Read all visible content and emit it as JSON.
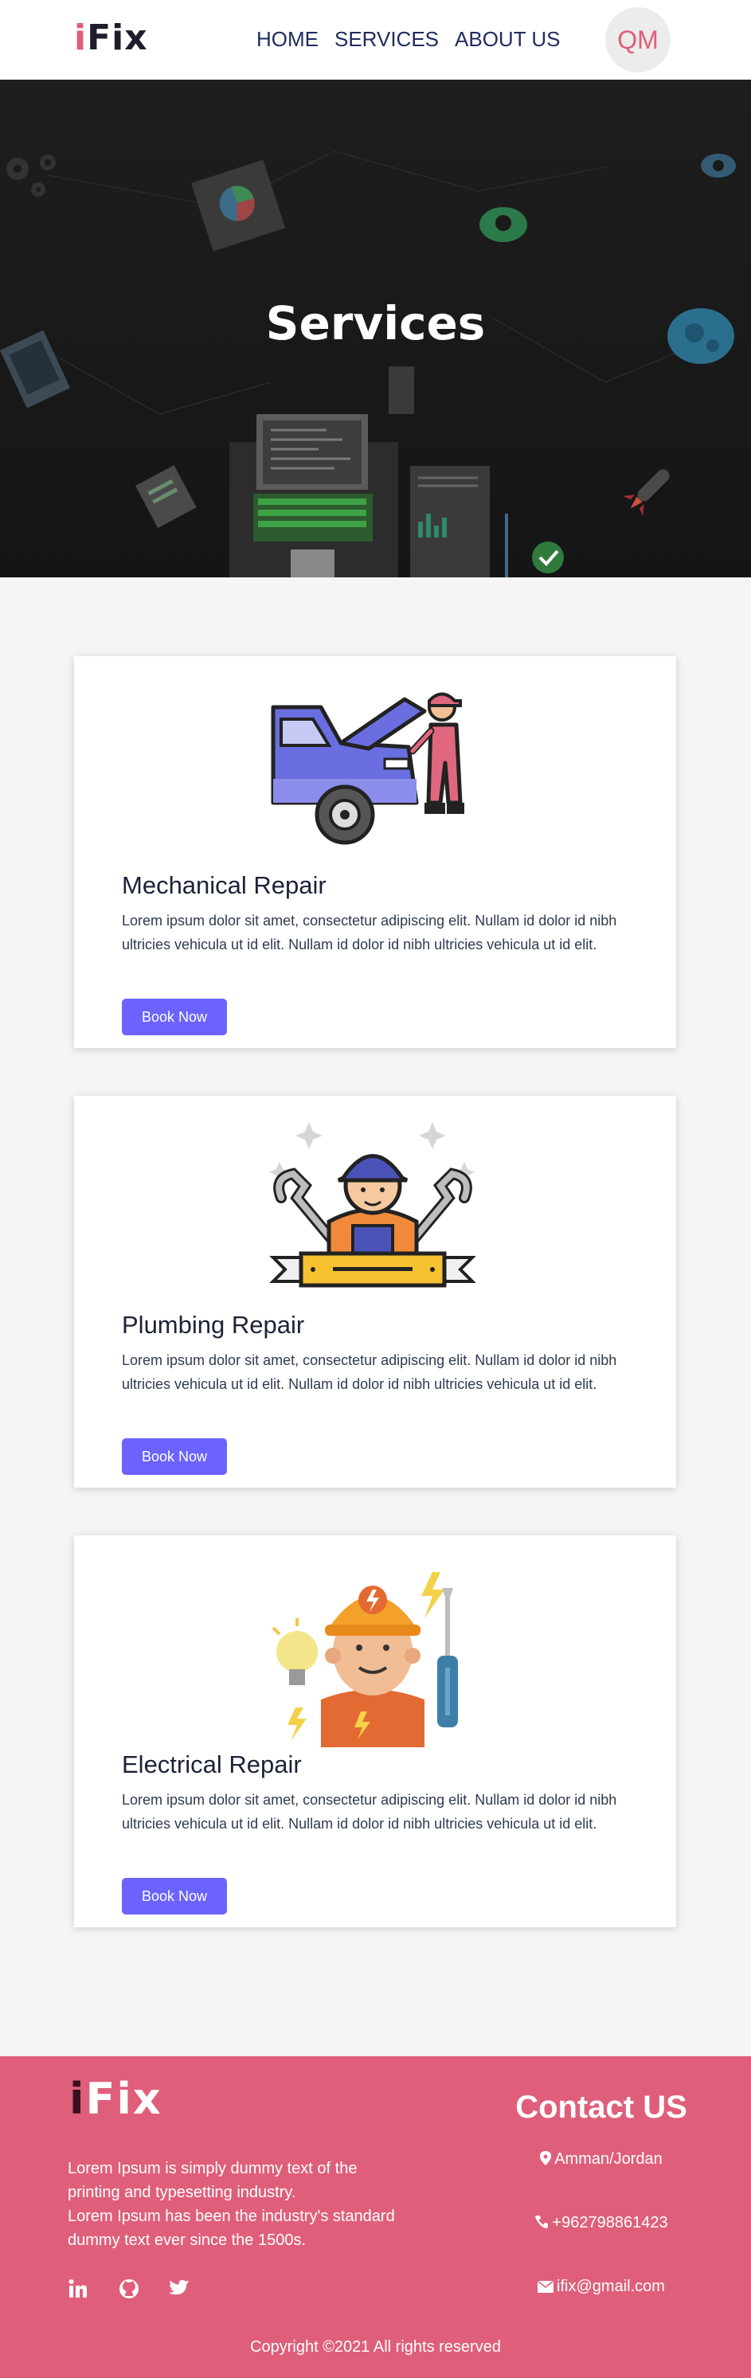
{
  "brand": {
    "logo_i": "i",
    "logo_fix": "Fix",
    "accent": "#e05d7a",
    "button_color": "#6c63ff"
  },
  "nav": {
    "items": [
      {
        "label": "HOME"
      },
      {
        "label": "SERVICES"
      },
      {
        "label": "ABOUT US"
      }
    ],
    "avatar_initials": "QM"
  },
  "hero": {
    "title": "Services"
  },
  "services": [
    {
      "title": "Mechanical Repair",
      "text": "Lorem ipsum dolor sit amet, consectetur adipiscing elit. Nullam id dolor id nibh ultricies vehicula ut id elit. Nullam id dolor id nibh ultricies vehicula ut id elit.",
      "button": "Book Now",
      "icon": "car-mechanic-icon"
    },
    {
      "title": "Plumbing Repair",
      "text": "Lorem ipsum dolor sit amet, consectetur adipiscing elit. Nullam id dolor id nibh ultricies vehicula ut id elit. Nullam id dolor id nibh ultricies vehicula ut id elit.",
      "button": "Book Now",
      "icon": "plumber-icon"
    },
    {
      "title": "Electrical Repair",
      "text": "Lorem ipsum dolor sit amet, consectetur adipiscing elit. Nullam id dolor id nibh ultricies vehicula ut id elit. Nullam id dolor id nibh ultricies vehicula ut id elit.",
      "button": "Book Now",
      "icon": "electrician-icon"
    }
  ],
  "footer": {
    "logo_i": "i",
    "logo_fix": "Fix",
    "description_1": "Lorem Ipsum is simply dummy text of the printing and typesetting industry.",
    "description_2": "Lorem Ipsum has been the industry's standard dummy text ever since the 1500s.",
    "socials": [
      "linkedin-icon",
      "github-icon",
      "twitter-icon"
    ],
    "contact_title": "Contact US",
    "location": "Amman/Jordan",
    "phone": "+962798861423",
    "email": "ifix@gmail.com",
    "copyright": "Copyright ©2021 All rights reserved"
  }
}
